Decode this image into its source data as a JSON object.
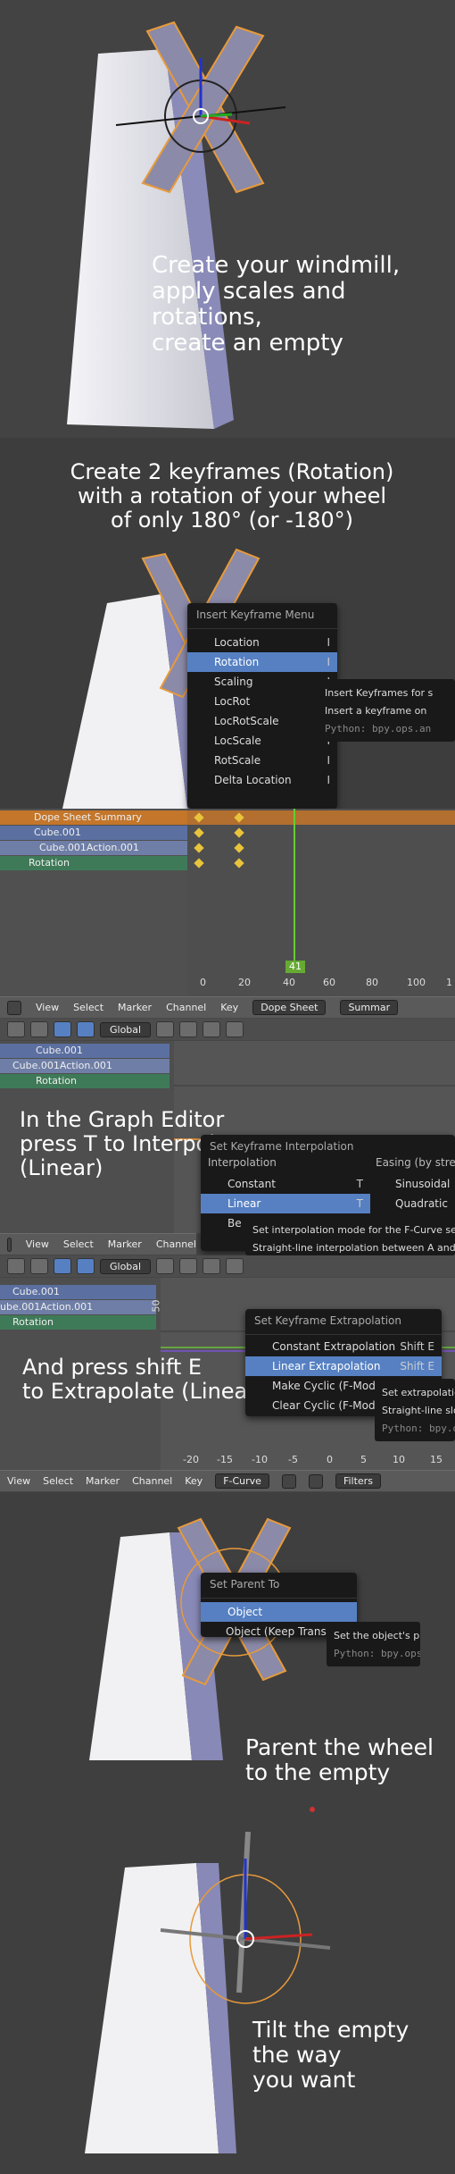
{
  "captions": {
    "step1": "Create your windmill,\napply scales and rotations,\ncreate an empty",
    "step2": "Create 2 keyframes (Rotation)\nwith a rotation of your wheel\nof only 180° (or -180°)",
    "step3": "In the Graph Editor\npress T to Interpolate\n(Linear)",
    "step4": "And press shift E\nto Extrapolate (Linear)",
    "step5": "Parent the wheel\nto the empty",
    "step6": "Tilt the empty\nthe way\nyou want"
  },
  "insert_keyframe_menu": {
    "title": "Insert Keyframe Menu",
    "items": [
      {
        "label": "Location",
        "key": "I"
      },
      {
        "label": "Rotation",
        "key": "I"
      },
      {
        "label": "Scaling",
        "key": "I"
      },
      {
        "label": "LocRot",
        "key": "I"
      },
      {
        "label": "LocRotScale",
        "key": "I"
      },
      {
        "label": "LocScale",
        "key": "I"
      },
      {
        "label": "RotScale",
        "key": "I"
      },
      {
        "label": "Delta Location",
        "key": "I"
      }
    ],
    "tooltip_title": "Insert Keyframes for s",
    "tooltip_desc": "Insert a keyframe on",
    "tooltip_python": "Python: bpy.ops.an"
  },
  "dope_sheet": {
    "channels": [
      "Dope Sheet Summary",
      "Cube.001",
      "Cube.001Action.001",
      "Rotation"
    ],
    "ticks": [
      "0",
      "20",
      "40",
      "60",
      "80",
      "100",
      "1"
    ],
    "current_frame": "41",
    "menu": [
      "View",
      "Select",
      "Marker",
      "Channel",
      "Key"
    ],
    "mode": "Dope Sheet",
    "summary_btn": "Summar"
  },
  "graph_editor_1": {
    "orientation": "Global",
    "channels": [
      "Cube.001",
      "Cube.001Action.001",
      "Rotation"
    ],
    "interp_menu": {
      "title": "Set Keyframe Interpolation",
      "col1_header": "Interpolation",
      "col2_header": "Easing (by stren",
      "items": [
        {
          "label": "Constant",
          "key": "T"
        },
        {
          "label": "Linear",
          "key": "T"
        },
        {
          "label": "Be",
          "key": ""
        }
      ],
      "easing": [
        "Sinusoidal",
        "Quadratic"
      ],
      "tooltip_title": "Set interpolation mode for the F-Curve seg",
      "tooltip_desc": "Straight-line interpolation between A and B"
    },
    "menu": [
      "View",
      "Select",
      "Marker",
      "Channel"
    ]
  },
  "graph_editor_2": {
    "orientation": "Global",
    "channels": [
      "Cube.001",
      "ube.001Action.001",
      "Rotation"
    ],
    "axis_label": "50",
    "extrap_menu": {
      "title": "Set Keyframe Extrapolation",
      "items": [
        {
          "label": "Constant Extrapolation",
          "key": "Shift E"
        },
        {
          "label": "Linear Extrapolation",
          "key": "Shift E"
        },
        {
          "label": "Make Cyclic (F-Modif",
          "key": ""
        },
        {
          "label": "Clear Cyclic (F-Modif",
          "key": ""
        }
      ],
      "tooltip_title": "Set extrapolatio",
      "tooltip_desc": "Straight-line slo",
      "tooltip_python": "Python: bpy.o"
    },
    "ticks": [
      "-20",
      "-15",
      "-10",
      "-5",
      "0",
      "5",
      "10",
      "15"
    ],
    "menu": [
      "View",
      "Select",
      "Marker",
      "Channel",
      "Key"
    ],
    "mode": "F-Curve",
    "filters": "Filters"
  },
  "parent_menu": {
    "title": "Set Parent To",
    "items": [
      "Object",
      "Object (Keep Transfo"
    ],
    "tooltip_title": "Set the object's pa",
    "tooltip_python": "Python: bpy.ops"
  },
  "colors": {
    "background": "#3d3d3d",
    "highlight": "#5680c2",
    "keyframe": "#e8c33c",
    "selection_orange": "#f39a2b"
  }
}
